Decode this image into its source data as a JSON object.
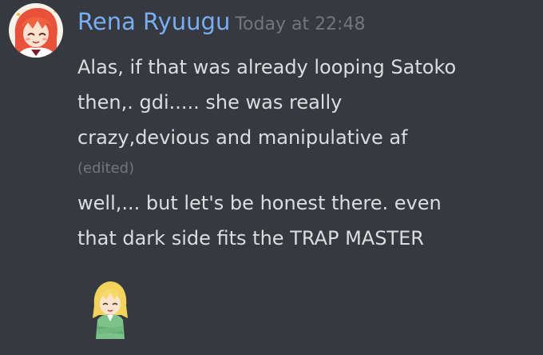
{
  "author": {
    "username": "Rena Ryuugu",
    "timestamp": "Today at 22:48",
    "username_color": "#79aef5"
  },
  "messages": [
    {
      "lines": [
        "Alas, if that was already  looping Satoko",
        "then,. gdi..... she was really",
        "crazy,devious and manipulative af"
      ],
      "edited_label": "(edited)"
    },
    {
      "lines": [
        "well,... but let's be honest there. even",
        "that dark side fits the TRAP MASTER"
      ]
    }
  ],
  "emoji": {
    "name": "custom-anime-girl-emoji"
  },
  "colors": {
    "background": "#36393f",
    "text": "#dcddde",
    "muted": "#72767d"
  }
}
